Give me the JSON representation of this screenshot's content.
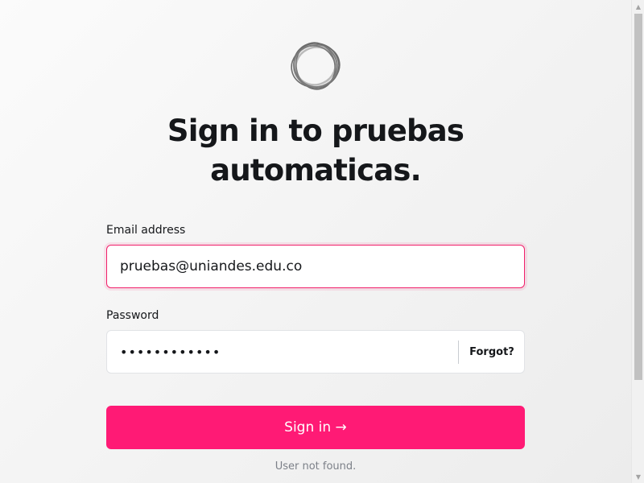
{
  "site": {
    "logo_icon": "ghost-ring-logo-icon"
  },
  "header": {
    "title": "Sign in to pruebas automaticas."
  },
  "form": {
    "email_label": "Email address",
    "email_value": "pruebas@uniandes.edu.co",
    "password_label": "Password",
    "password_value": "pruebas12345",
    "forgot_label": "Forgot?",
    "submit_label": "Sign in →",
    "status_message": "User not found."
  },
  "colors": {
    "accent": "#ff1a75",
    "error_border": "#f11f6a",
    "status_text": "#7c8088"
  }
}
